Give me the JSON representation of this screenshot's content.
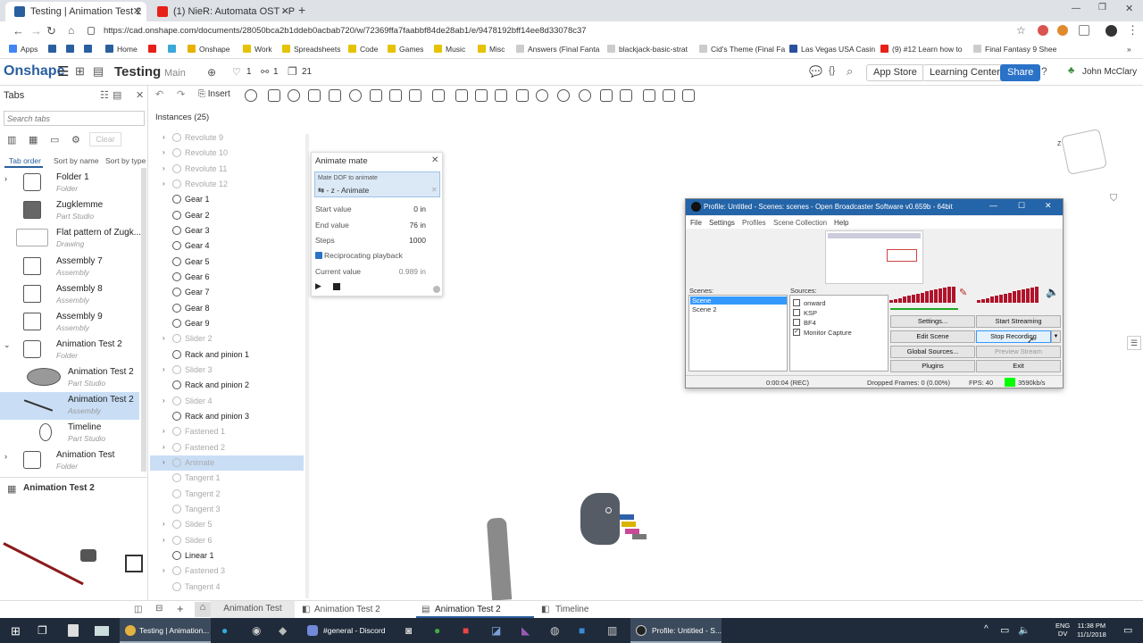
{
  "browser": {
    "tabs": [
      {
        "title": "Testing | Animation Test 2",
        "active": true
      },
      {
        "title": "(1) NieR: Automata OST - Peace",
        "active": false
      }
    ],
    "url": "https://cad.onshape.com/documents/28050bca2b1ddeb0acbab720/w/72369ffa7faabbf84de28ab1/e/9478192bff14ee8d33078c37",
    "bookmarks": [
      "Apps",
      "Home",
      "Onshape",
      "Work",
      "Spreadsheets",
      "Code",
      "Games",
      "Music",
      "Misc",
      "Answers (Final Fanta",
      "blackjack-basic-strat",
      "Cid's Theme (Final Fa",
      "Las Vegas USA Casin",
      "(9) #12 Learn how to",
      "Final Fantasy 9 Shee"
    ]
  },
  "onshape": {
    "logo": "Onshape",
    "doc_title": "Testing",
    "workspace": "Main",
    "counts": {
      "likes": "1",
      "links": "1",
      "versions": "21"
    },
    "header_buttons": {
      "app_store": "App Store",
      "learning": "Learning Center",
      "share": "Share",
      "user": "John McClary"
    },
    "toolbar_insert": "Insert"
  },
  "tabs_panel": {
    "title": "Tabs",
    "search_placeholder": "Search tabs",
    "clear": "Clear",
    "sort": [
      "Tab order",
      "Sort by name",
      "Sort by type"
    ],
    "items": [
      {
        "name": "Folder 1",
        "type": "Folder"
      },
      {
        "name": "Zugklemme",
        "type": "Part Studio"
      },
      {
        "name": "Flat pattern of Zugk...",
        "type": "Drawing"
      },
      {
        "name": "Assembly 7",
        "type": "Assembly"
      },
      {
        "name": "Assembly 8",
        "type": "Assembly"
      },
      {
        "name": "Assembly 9",
        "type": "Assembly"
      },
      {
        "name": "Animation Test 2",
        "type": "Folder"
      },
      {
        "name": "Animation Test 2",
        "type": "Part Studio"
      },
      {
        "name": "Animation Test 2",
        "type": "Assembly"
      },
      {
        "name": "Timeline",
        "type": "Part Studio"
      },
      {
        "name": "Animation Test",
        "type": "Folder"
      }
    ],
    "preview_title": "Animation Test 2"
  },
  "instances": {
    "title": "Instances (25)",
    "items": [
      "Revolute 9",
      "Revolute 10",
      "Revolute 11",
      "Revolute 12",
      "Gear 1",
      "Gear 2",
      "Gear 3",
      "Gear 4",
      "Gear 5",
      "Gear 6",
      "Gear 7",
      "Gear 8",
      "Gear 9",
      "Slider 2",
      "Rack and pinion 1",
      "Slider 3",
      "Rack and pinion 2",
      "Slider 4",
      "Rack and pinion 3",
      "Fastened 1",
      "Fastened 2",
      "Animate",
      "Tangent 1",
      "Tangent 2",
      "Tangent 3",
      "Slider 5",
      "Slider 6",
      "Linear 1",
      "Fastened 3",
      "Tangent 4"
    ]
  },
  "animate_dialog": {
    "title": "Animate mate",
    "dof_label": "Mate DOF to animate",
    "dof_value": "⇆ - z - Animate",
    "start_label": "Start value",
    "start_value": "0 in",
    "end_label": "End value",
    "end_value": "76 in",
    "steps_label": "Steps",
    "steps_value": "1000",
    "recip_label": "Reciprocating playback",
    "current_label": "Current value",
    "current_value": "0.989 in"
  },
  "obs": {
    "title": "Profile: Untitled - Scenes: scenes - Open Broadcaster Software v0.659b - 64bit",
    "menu": [
      "File",
      "Settings",
      "Profiles",
      "Scene Collection",
      "Help"
    ],
    "scenes_label": "Scenes:",
    "scenes": [
      "Scene",
      "Scene 2"
    ],
    "sources_label": "Sources:",
    "sources": [
      {
        "name": "onward",
        "checked": false
      },
      {
        "name": "KSP",
        "checked": false
      },
      {
        "name": "BF4",
        "checked": false
      },
      {
        "name": "Monitor Capture",
        "checked": true
      }
    ],
    "buttons": [
      "Settings...",
      "Start Streaming",
      "Edit Scene",
      "Stop Recording",
      "Global Sources...",
      "Preview Stream",
      "Plugins",
      "Exit"
    ],
    "status_time": "0:00:04 (REC)",
    "status_dropped": "Dropped Frames: 0 (0.00%)",
    "status_fps": "FPS: 40",
    "status_rate": "3590kb/s"
  },
  "bottom_tabs": [
    "Animation Test",
    "Animation Test 2",
    "Animation Test 2",
    "Timeline"
  ],
  "taskbar": {
    "items": [
      "Testing | Animation...",
      "#general - Discord",
      "Profile: Untitled - S..."
    ],
    "lang": "ENG",
    "lang2": "DV",
    "time": "11:38 PM",
    "date": "11/1/2018"
  }
}
